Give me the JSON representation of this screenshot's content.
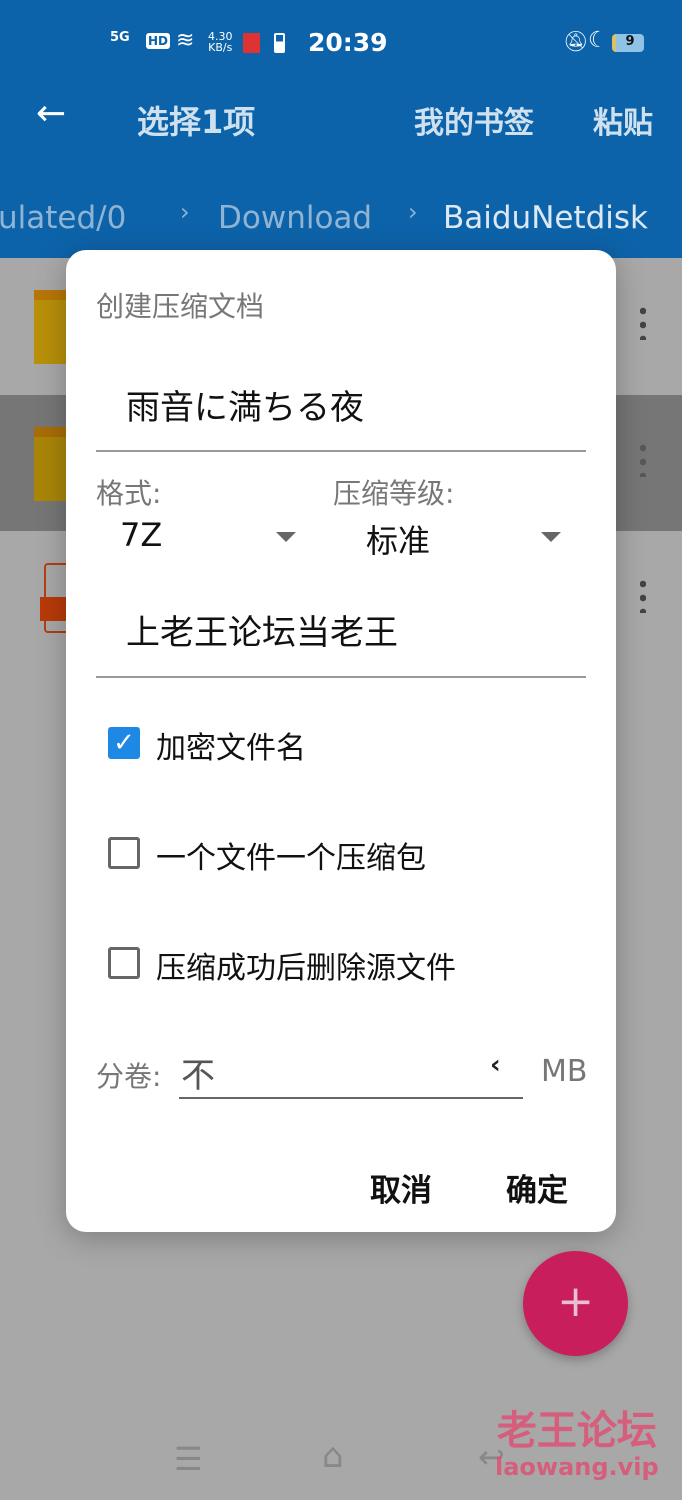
{
  "status": {
    "network": "5G",
    "hd": "HD",
    "speed_top": "4.30",
    "speed_unit": "KB/s",
    "time": "20:39",
    "battery": "9"
  },
  "toolbar": {
    "title": "选择1项",
    "bookmarks": "我的书签",
    "paste": "粘贴"
  },
  "breadcrumb": [
    "ulated/0",
    "Download",
    "BaiduNetdisk"
  ],
  "dialog": {
    "title": "创建压缩文档",
    "filename": "雨音に満ちる夜",
    "format_label": "格式:",
    "format_value": "7Z",
    "level_label": "压缩等级:",
    "level_value": "标准",
    "password": "上老王论坛当老王",
    "options": [
      {
        "label": "加密文件名",
        "checked": true
      },
      {
        "label": "一个文件一个压缩包",
        "checked": false
      },
      {
        "label": "压缩成功后删除源文件",
        "checked": false
      }
    ],
    "split_label": "分卷:",
    "split_value": "不",
    "split_unit": "MB",
    "cancel": "取消",
    "ok": "确定"
  },
  "fab": "+",
  "watermark": {
    "line1": "老王论坛",
    "line2": "laowang.vip"
  },
  "colors": {
    "primary": "#0d63a9",
    "accent": "#1e88e5",
    "fab": "#c81e5c"
  }
}
